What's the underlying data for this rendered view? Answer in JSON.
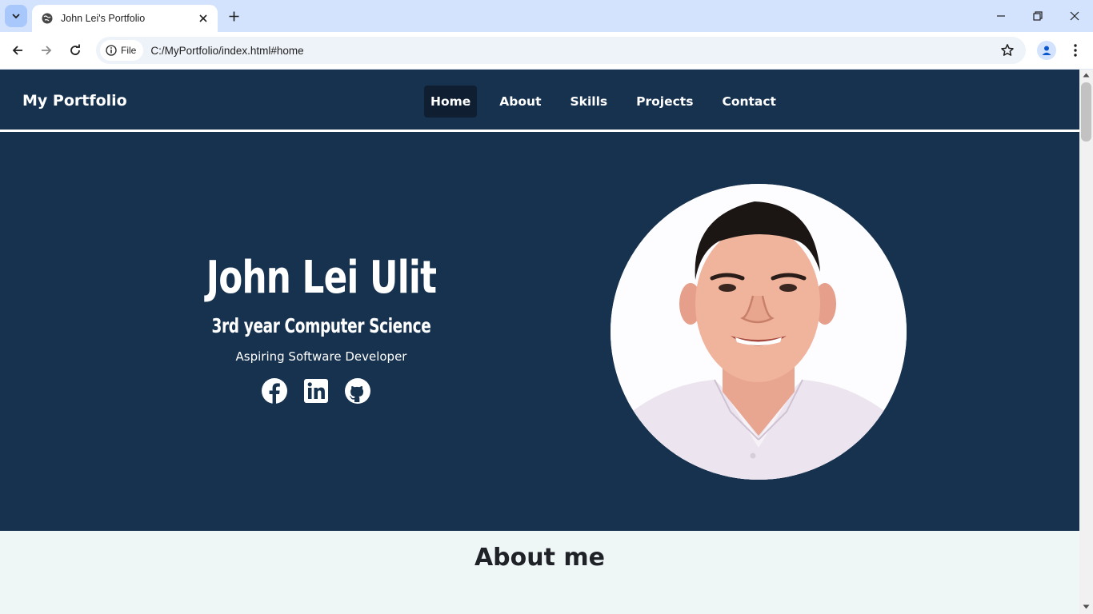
{
  "browser": {
    "tab_title": "John Lei's Portfolio",
    "chip_label": "File",
    "url": "C:/MyPortfolio/index.html#home",
    "icons": [
      "tab-search-icon",
      "globe-icon",
      "close-icon",
      "plus-icon",
      "minimize-icon",
      "restore-icon",
      "close-window-icon",
      "back-icon",
      "forward-icon",
      "reload-icon",
      "info-icon",
      "star-icon",
      "profile-icon",
      "more-icon"
    ]
  },
  "site": {
    "brand": "My Portfolio",
    "nav": [
      {
        "label": "Home",
        "active": true
      },
      {
        "label": "About",
        "active": false
      },
      {
        "label": "Skills",
        "active": false
      },
      {
        "label": "Projects",
        "active": false
      },
      {
        "label": "Contact",
        "active": false
      }
    ]
  },
  "hero": {
    "name": "John Lei Ulit",
    "year": "3rd year Computer Science",
    "role": "Aspiring Software Developer",
    "socials": [
      "facebook-icon",
      "linkedin-icon",
      "github-icon"
    ]
  },
  "about": {
    "title": "About me"
  },
  "colors": {
    "navy": "#17324f",
    "active_nav": "#0f1f31",
    "about_bg": "#eef6f6",
    "tabstrip": "#d3e3fd"
  }
}
